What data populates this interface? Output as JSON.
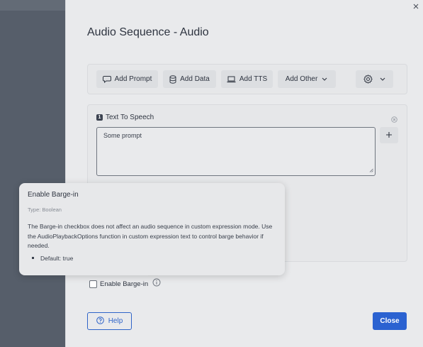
{
  "modal": {
    "title": "Audio Sequence - Audio"
  },
  "toolbar": {
    "add_prompt": "Add Prompt",
    "add_data": "Add Data",
    "add_tts": "Add TTS",
    "add_other": "Add Other"
  },
  "tts": {
    "index": "1",
    "label": "Text To Speech",
    "value": "Some prompt"
  },
  "barge": {
    "label": "Enable Barge-in",
    "checked": false
  },
  "tooltip": {
    "title": "Enable Barge-in",
    "type": "Type: Boolean",
    "description": "The Barge-in checkbox does not affect an audio sequence in custom expression mode. Use the AudioPlaybackOptions function in custom expression text to control barge behavior if needed.",
    "default": "Default: true"
  },
  "footer": {
    "help": "Help",
    "close": "Close"
  },
  "colors": {
    "primary": "#2b62d1",
    "backdrop": "#565e6a",
    "modal_bg": "#e9eaec"
  }
}
